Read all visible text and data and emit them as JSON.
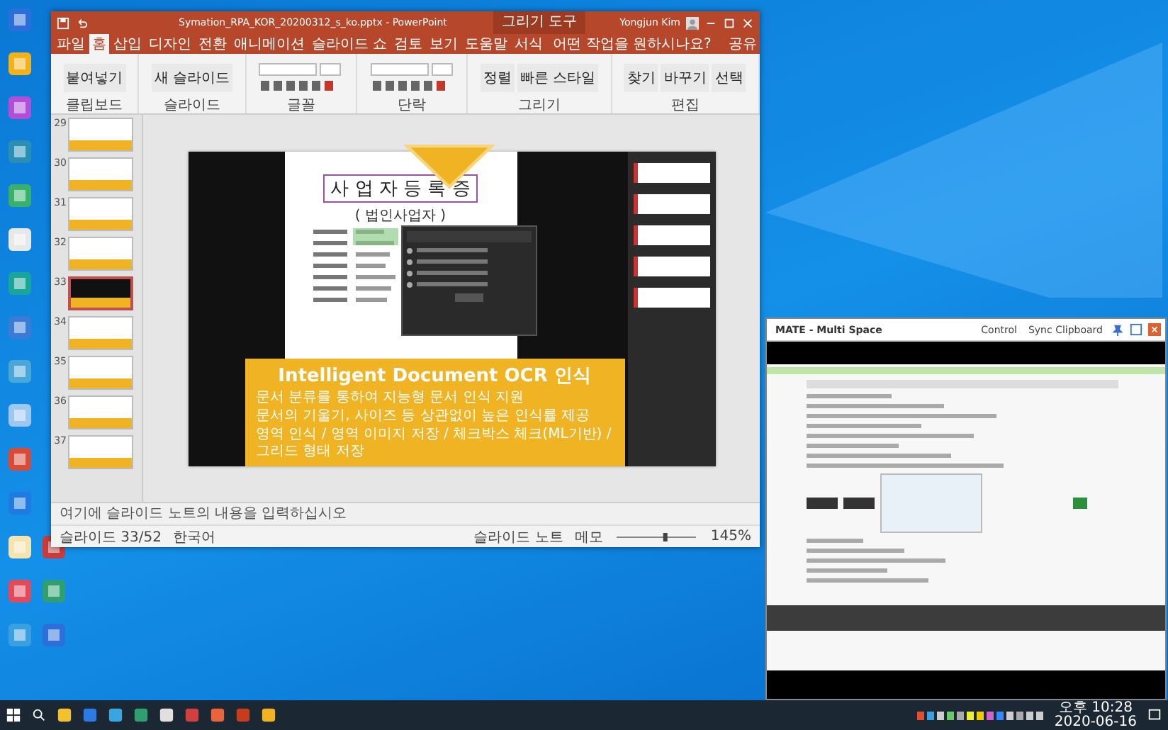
{
  "powerpoint": {
    "title": "Symation_RPA_KOR_20200312_s_ko.pptx - PowerPoint",
    "context_group": "그리기 도구",
    "user": "Yongjun Kim",
    "tabs": [
      {
        "label": "파일",
        "selected": false
      },
      {
        "label": "홈",
        "selected": true
      },
      {
        "label": "삽입",
        "selected": false
      },
      {
        "label": "디자인",
        "selected": false
      },
      {
        "label": "전환",
        "selected": false
      },
      {
        "label": "애니메이션",
        "selected": false
      },
      {
        "label": "슬라이드 쇼",
        "selected": false
      },
      {
        "label": "검토",
        "selected": false
      },
      {
        "label": "보기",
        "selected": false
      },
      {
        "label": "도움말",
        "selected": false
      },
      {
        "label": "서식",
        "selected": false
      }
    ],
    "search_hint": "어떤 작업을 원하시나요?",
    "share": "공유",
    "ribbon_groups": [
      {
        "label": "클립보드",
        "buttons": [
          "붙여넣기"
        ]
      },
      {
        "label": "슬라이드",
        "buttons": [
          "새 슬라이드"
        ]
      },
      {
        "label": "글꼴"
      },
      {
        "label": "단락"
      },
      {
        "label": "그리기",
        "buttons": [
          "정렬",
          "빠른 스타일"
        ]
      },
      {
        "label": "편집",
        "buttons": [
          "찾기",
          "바꾸기",
          "선택"
        ]
      }
    ],
    "thumbnails": [
      {
        "number": "29",
        "selected": false
      },
      {
        "number": "30",
        "selected": false
      },
      {
        "number": "31",
        "selected": false
      },
      {
        "number": "32",
        "selected": false
      },
      {
        "number": "33",
        "selected": true
      },
      {
        "number": "34",
        "selected": false
      },
      {
        "number": "35",
        "selected": false
      },
      {
        "number": "36",
        "selected": false
      },
      {
        "number": "37",
        "selected": false
      }
    ],
    "slide": {
      "doc_title": "사 업 자 등 록 증",
      "doc_subtitle": "( 법인사업자 )",
      "heading": "Intelligent Document OCR 인식",
      "bullets": [
        "문서 분류를 통하여 지능형 문서 인식 지원",
        "문서의 기울기, 사이즈 등 상관없이 높은 인식률 제공",
        "영역 인식 / 영역 이미지 저장 / 체크박스 체크(ML기반) / 그리드 형태 저장"
      ]
    },
    "notes_placeholder": "여기에 슬라이드 노트의 내용을 입력하십시오",
    "status": {
      "slide_counter": "슬라이드 33/52",
      "language": "한국어",
      "notes": "슬라이드 노트",
      "comments": "메모",
      "zoom_slider": {
        "level": 0.62
      },
      "zoom": "145%"
    }
  },
  "multispace": {
    "title": "MATE - Multi Space",
    "buttons": [
      "Control",
      "Sync Clipboard"
    ]
  },
  "taskbar": {
    "time": "오후 10:28",
    "date": "2020-06-16"
  }
}
